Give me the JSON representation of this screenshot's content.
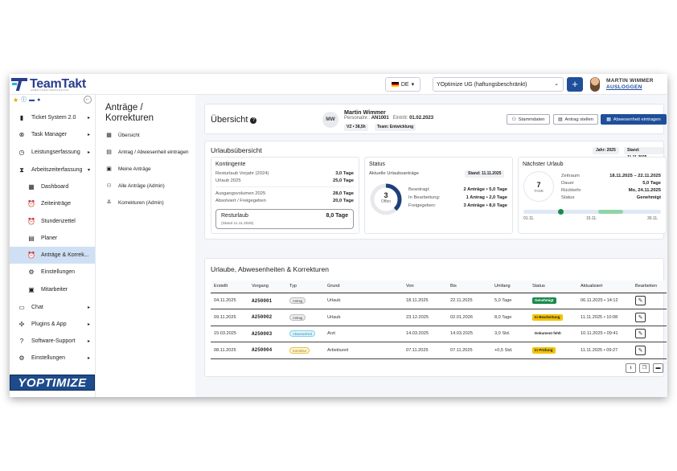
{
  "app": {
    "logo_text": "TeamTakt",
    "logo_sub": "ARBEITSZEITERFASSUNG",
    "language": "DE",
    "company": "YOptimize UG (haftungsbeschränkt)",
    "user_name": "MARTIN WIMMER",
    "logout": "AUSLOGGEN",
    "plus": "+",
    "brand": "YOPTIMIZE"
  },
  "sidebar": {
    "items": [
      {
        "label": "Ticket System 2.0",
        "icon": "ticket-icon",
        "glyph": "▮",
        "arrow": "▸"
      },
      {
        "label": "Task Manager",
        "icon": "task-icon",
        "glyph": "⊗",
        "arrow": "▸"
      },
      {
        "label": "Leistungserfassung",
        "icon": "clock-icon",
        "glyph": "◷",
        "arrow": "▸"
      },
      {
        "label": "Arbeitszeiterfassung",
        "icon": "hourglass-icon",
        "glyph": "⧗",
        "arrow": "▾"
      },
      {
        "label": "Dashboard",
        "icon": "dashboard-icon",
        "glyph": "▦",
        "arrow": ""
      },
      {
        "label": "Zeiteinträge",
        "icon": "alarm-icon",
        "glyph": "⏰",
        "arrow": ""
      },
      {
        "label": "Stundenzettel",
        "icon": "alarm-icon",
        "glyph": "⏰",
        "arrow": ""
      },
      {
        "label": "Planer",
        "icon": "calendar-icon",
        "glyph": "▤",
        "arrow": ""
      },
      {
        "label": "Anträge & Korrek...",
        "icon": "alarm-icon",
        "glyph": "⏰",
        "arrow": ""
      },
      {
        "label": "Einstellungen",
        "icon": "gear-icon",
        "glyph": "⚙",
        "arrow": ""
      },
      {
        "label": "Mitarbeiter",
        "icon": "id-card-icon",
        "glyph": "▣",
        "arrow": ""
      },
      {
        "label": "Chat",
        "icon": "chat-icon",
        "glyph": "▭",
        "arrow": "▸"
      },
      {
        "label": "Plugins & App",
        "icon": "plugin-icon",
        "glyph": "✣",
        "arrow": "▸"
      },
      {
        "label": "Software-Support",
        "icon": "help-icon",
        "glyph": "?",
        "arrow": "▸"
      },
      {
        "label": "Einstellungen",
        "icon": "gear-icon",
        "glyph": "⚙",
        "arrow": "▸"
      }
    ]
  },
  "subnav": {
    "title": "Anträge / Korrekturen",
    "items": [
      {
        "label": "Übersicht",
        "glyph": "▦"
      },
      {
        "label": "Antrag / Abwesenheit eintragen",
        "glyph": "▤"
      },
      {
        "label": "Meine Anträge",
        "glyph": "▣"
      },
      {
        "label": "Alle Anträge (Admin)",
        "glyph": "⚇"
      },
      {
        "label": "Korrekturen (Admin)",
        "glyph": "≚"
      }
    ]
  },
  "overview": {
    "title": "Übersicht",
    "initials": "MW",
    "name": "Martin Wimmer",
    "personalnr_label": "Personalnr.:",
    "personalnr": "AN1001",
    "eintritt_label": "Eintritt:",
    "eintritt": "01.02.2023",
    "tag_vz": "VZ • 38,5h",
    "tag_team": "Team: Entwicklung",
    "btn_stammdaten": "Stammdaten",
    "btn_antrag": "Antrag stellen",
    "btn_abwesenheit": "Abwesenheit eintragen"
  },
  "urlaub": {
    "title": "Urlaubsübersicht",
    "jahr": "Jahr: 2025",
    "stand": "Stand: 11.11.2025",
    "kontingente": {
      "title": "Kontingente",
      "rows": [
        {
          "k": "Resturlaub Vorjahr (2024)",
          "v": "3,0 Tage"
        },
        {
          "k": "Urlaub 2025",
          "v": "25,0 Tage"
        },
        {
          "k": "Ausgangsvolumen 2025",
          "v": "28,0 Tage"
        },
        {
          "k": "Absolviert / Freigegeben",
          "v": "20,0 Tage"
        }
      ],
      "rest_label": "Resturlaub",
      "rest_value": "8,0 Tage",
      "rest_stand": "(Stand 11.11.2025)"
    },
    "status": {
      "title": "Status",
      "sub": "Aktuelle Urlaubsanträge",
      "stand": "Stand: 11.11.2025",
      "open_count": "3",
      "open_label": "Offen",
      "open_fraction": 0.38,
      "rows": [
        {
          "k": "Beantragt:",
          "v": "2 Anträge • 5,0 Tage"
        },
        {
          "k": "In Bearbeitung:",
          "v": "1 Antrag • 2,0 Tage"
        },
        {
          "k": "Freigegeben:",
          "v": "3 Anträge • 8,0 Tage"
        }
      ]
    },
    "next": {
      "title": "Nächster Urlaub",
      "days": "7",
      "days_label": "TAGE",
      "rows": [
        {
          "k": "Zeitraum",
          "v": "18.11.2025 – 22.11.2025"
        },
        {
          "k": "Dauer",
          "v": "5,0 Tage"
        },
        {
          "k": "Rückkehr",
          "v": "Mo, 24.11.2025"
        },
        {
          "k": "Status",
          "v": "Genehmigt"
        }
      ],
      "timeline": [
        "01.11.",
        "15.11.",
        "30.11."
      ]
    }
  },
  "table": {
    "title": "Urlaube, Abwesenheiten & Korrekturen",
    "headers": [
      "Erstellt",
      "Vorgang",
      "Typ",
      "Grund",
      "Von",
      "Bis",
      "Umfang",
      "Status",
      "Aktualisiert",
      "Bearbeiten"
    ],
    "rows": [
      {
        "erstellt": "04.11.2025",
        "vorgang": "A250001",
        "typ": "Antrag",
        "grund": "Urlaub",
        "von": "18.11.2025",
        "bis": "22.11.2025",
        "umfang": "5,0 Tage",
        "status": "Genehmigt",
        "aktualisiert": "06.11.2025 • 14:12"
      },
      {
        "erstellt": "09.11.2025",
        "vorgang": "A250002",
        "typ": "Antrag",
        "grund": "Urlaub",
        "von": "23.12.2025",
        "bis": "02.01.2026",
        "umfang": "8,0 Tage",
        "status": "In Bearbeitung",
        "aktualisiert": "11.11.2025 • 10:08"
      },
      {
        "erstellt": "15.03.2025",
        "vorgang": "A250003",
        "typ": "Abwesenheit",
        "grund": "Arzt",
        "von": "14.03.2025",
        "bis": "14.03.2025",
        "umfang": "3,0 Std.",
        "status": "Dokument fehlt",
        "aktualisiert": "10.11.2025 • 09:41"
      },
      {
        "erstellt": "08.11.2025",
        "vorgang": "A250004",
        "typ": "Korrektur",
        "grund": "Arbeitszeit",
        "von": "07.11.2025",
        "bis": "07.11.2025",
        "umfang": "+0,5 Std.",
        "status": "In Prüfung",
        "aktualisiert": "11.11.2025 • 09:27"
      }
    ]
  },
  "colors": {
    "primary": "#1f4f9a",
    "active_nav": "#cfe0f5",
    "approved": "#1a8a4a",
    "pending": "#f2c300"
  }
}
